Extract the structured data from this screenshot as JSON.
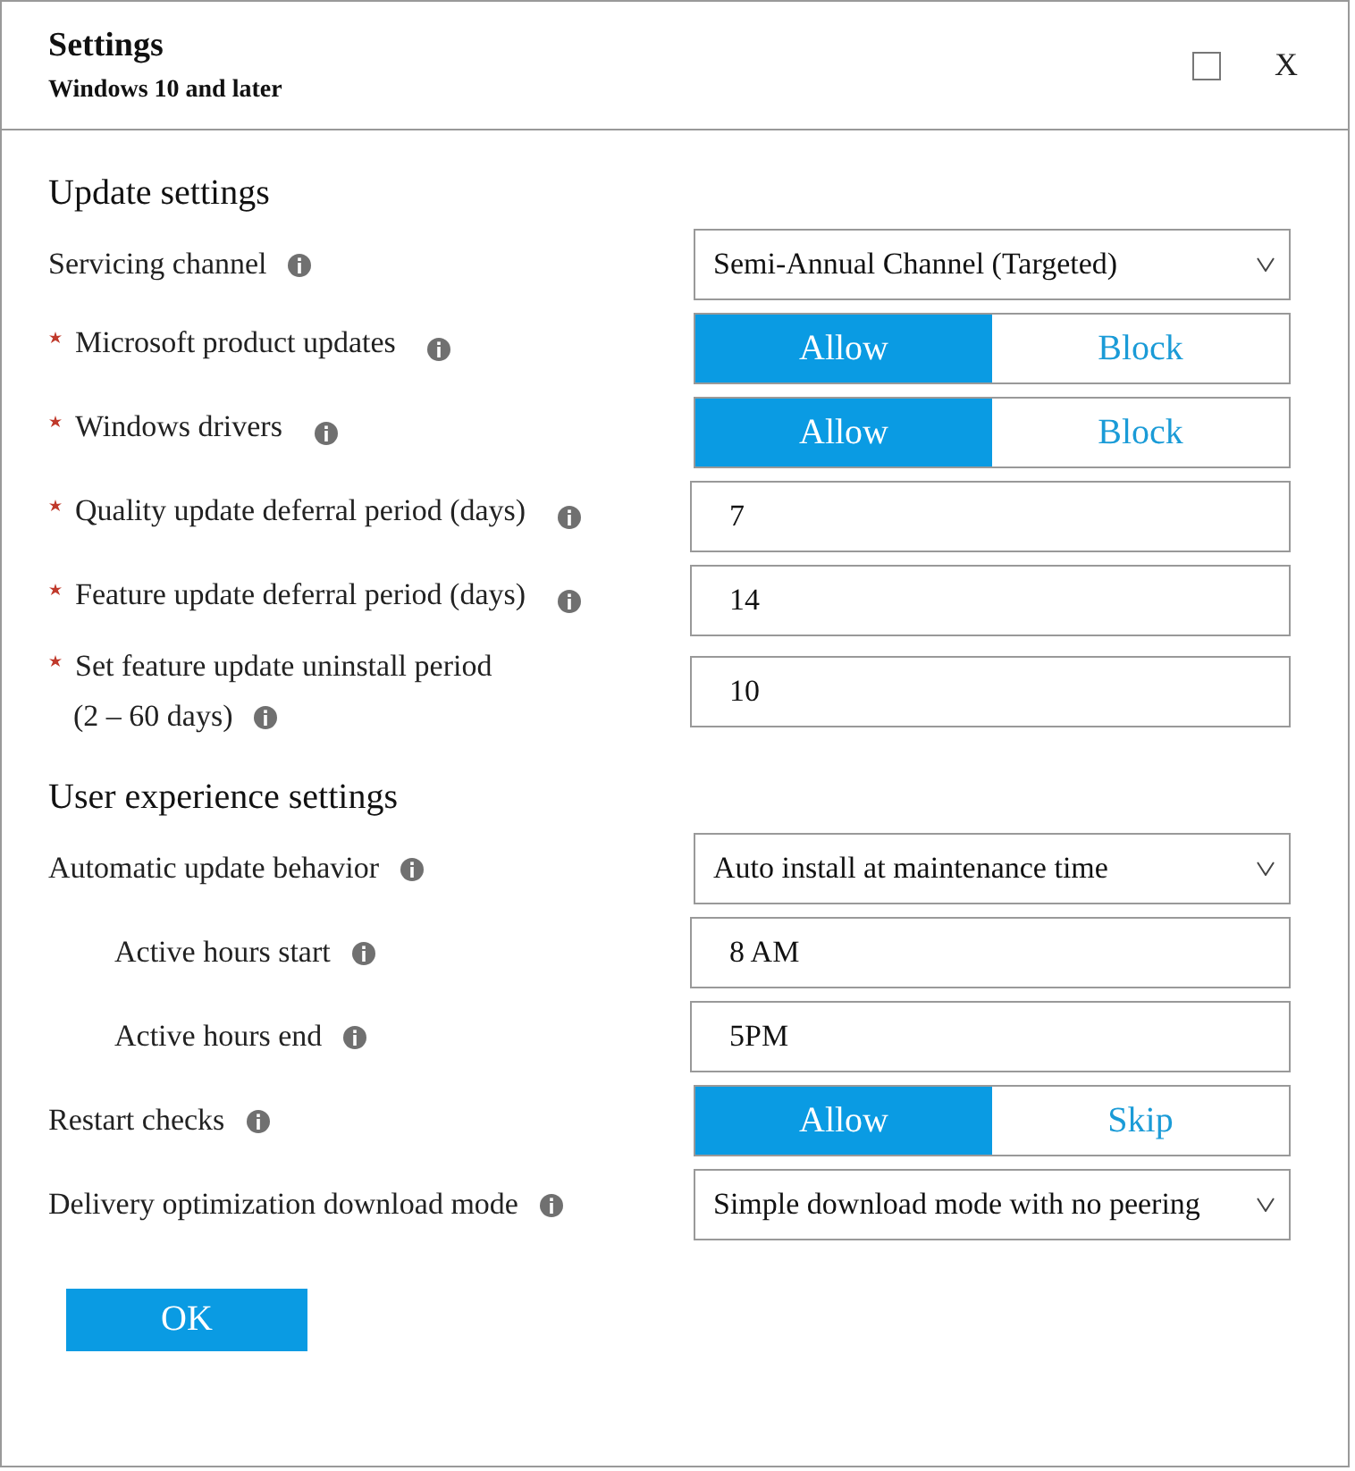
{
  "window": {
    "title": "Settings",
    "subtitle": "Windows 10 and later",
    "close": "X"
  },
  "sections": [
    {
      "heading": "Update settings",
      "rows": [
        {
          "kind": "dropdown",
          "label": "Servicing channel",
          "required": false,
          "indented": false,
          "value": "Semi-Annual Channel (Targeted)"
        },
        {
          "kind": "toggle",
          "label": "Microsoft product updates",
          "required": true,
          "indented": false,
          "options": [
            {
              "label": "Allow",
              "selected": true
            },
            {
              "label": "Block",
              "selected": false
            }
          ]
        },
        {
          "kind": "toggle",
          "label": "Windows drivers",
          "required": true,
          "indented": false,
          "options": [
            {
              "label": "Allow",
              "selected": true
            },
            {
              "label": "Block",
              "selected": false
            }
          ]
        },
        {
          "kind": "text",
          "label": "Quality update deferral period (days)",
          "required": true,
          "indented": false,
          "value": "7"
        },
        {
          "kind": "text",
          "label": "Feature update deferral period (days)",
          "required": true,
          "indented": false,
          "value": "14"
        },
        {
          "kind": "text",
          "label": "Set feature update uninstall period",
          "note": "(2 – 60 days)",
          "required": true,
          "indented": false,
          "value": "10"
        }
      ]
    },
    {
      "heading": "User experience settings",
      "rows": [
        {
          "kind": "dropdown",
          "label": "Automatic update behavior",
          "required": false,
          "indented": false,
          "value": "Auto install at maintenance time"
        },
        {
          "kind": "text",
          "label": "Active hours start",
          "required": false,
          "indented": true,
          "value": "8 AM"
        },
        {
          "kind": "text",
          "label": "Active hours end",
          "required": false,
          "indented": true,
          "value": "5PM"
        },
        {
          "kind": "toggle",
          "label": "Restart checks",
          "required": false,
          "indented": false,
          "options": [
            {
              "label": "Allow",
              "selected": true
            },
            {
              "label": "Skip",
              "selected": false
            }
          ]
        },
        {
          "kind": "dropdown",
          "label": "Delivery optimization download mode",
          "required": false,
          "indented": false,
          "value": "Simple download mode with no peering"
        }
      ]
    }
  ],
  "buttons": [
    "OK"
  ]
}
